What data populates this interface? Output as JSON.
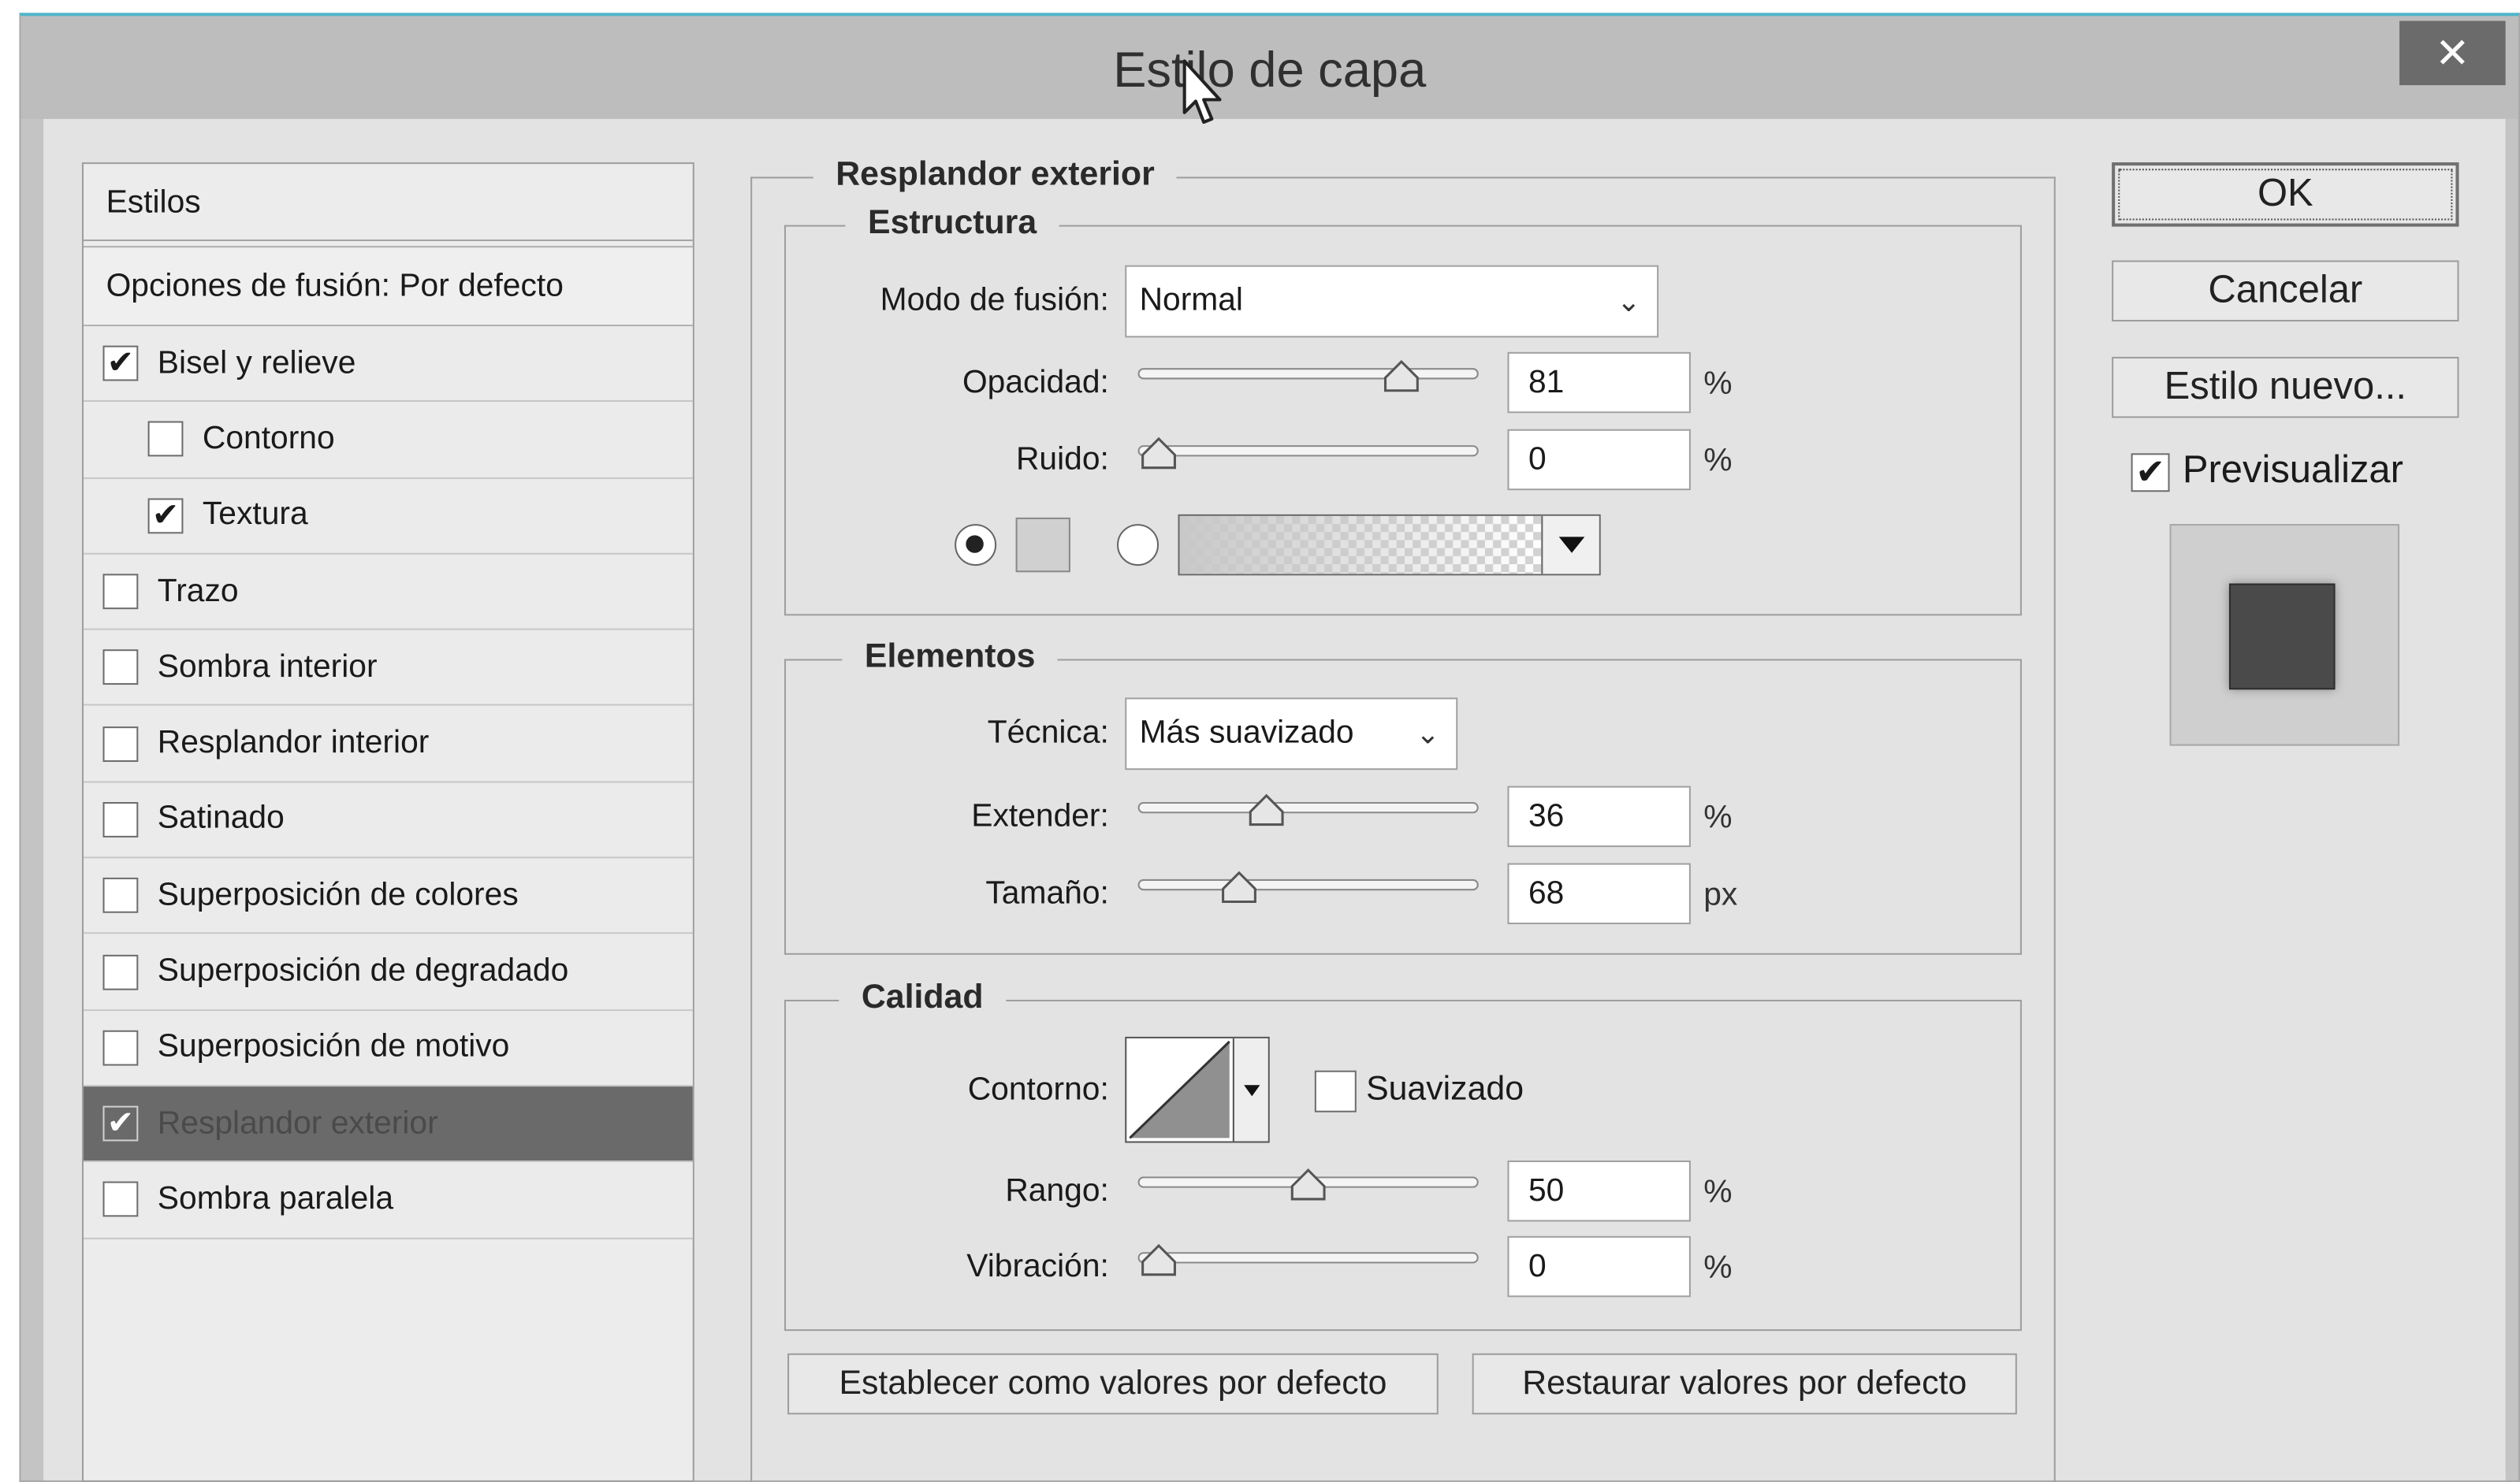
{
  "window": {
    "title": "Estilo de capa",
    "close_glyph": "✕"
  },
  "styles": {
    "header": "Estilos",
    "blend_options": "Opciones de fusión: Por defecto",
    "items": [
      {
        "label": "Bisel y relieve",
        "checked": true
      },
      {
        "label": "Contorno",
        "checked": false
      },
      {
        "label": "Textura",
        "checked": true
      },
      {
        "label": "Trazo",
        "checked": false
      },
      {
        "label": "Sombra interior",
        "checked": false
      },
      {
        "label": "Resplandor interior",
        "checked": false
      },
      {
        "label": "Satinado",
        "checked": false
      },
      {
        "label": "Superposición de colores",
        "checked": false
      },
      {
        "label": "Superposición de degradado",
        "checked": false
      },
      {
        "label": "Superposición de motivo",
        "checked": false
      },
      {
        "label": "Resplandor exterior",
        "checked": true
      },
      {
        "label": "Sombra paralela",
        "checked": false
      }
    ]
  },
  "outer_glow": {
    "title": "Resplandor exterior",
    "structure": {
      "title": "Estructura",
      "blend_mode_label": "Modo de fusión:",
      "blend_mode_value": "Normal",
      "opacity_label": "Opacidad:",
      "opacity_value": "81",
      "opacity_level": 0.81,
      "opacity_unit": "%",
      "noise_label": "Ruido:",
      "noise_value": "0",
      "noise_level": 0,
      "noise_unit": "%",
      "color_mode": "solid"
    },
    "elements": {
      "title": "Elementos",
      "technique_label": "Técnica:",
      "technique_value": "Más suavizado",
      "spread_label": "Extender:",
      "spread_value": "36",
      "spread_level": 0.36,
      "spread_unit": "%",
      "size_label": "Tamaño:",
      "size_value": "68",
      "size_level": 0.27,
      "size_unit": "px"
    },
    "quality": {
      "title": "Calidad",
      "contour_label": "Contorno:",
      "antialias_label": "Suavizado",
      "antialias_checked": false,
      "range_label": "Rango:",
      "range_value": "50",
      "range_level": 0.5,
      "range_unit": "%",
      "jitter_label": "Vibración:",
      "jitter_value": "0",
      "jitter_level": 0,
      "jitter_unit": "%"
    },
    "make_default_label": "Establecer como valores por defecto",
    "reset_default_label": "Restaurar valores por defecto"
  },
  "buttons": {
    "ok": "OK",
    "cancel": "Cancelar",
    "new_style": "Estilo nuevo...",
    "preview_label": "Previsualizar",
    "preview_checked": true
  },
  "colors": {
    "title_accent": "#4fb6c8",
    "selected_row": "#6a6a6a",
    "preview_swatch": "#4a4a4a"
  }
}
